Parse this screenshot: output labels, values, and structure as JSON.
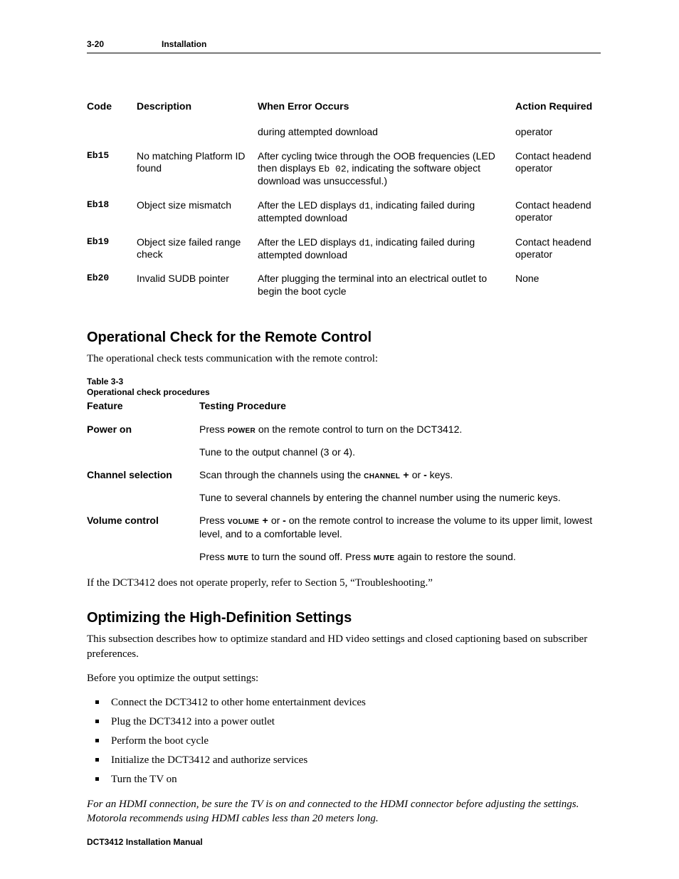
{
  "header": {
    "pagenum": "3-20",
    "section": "Installation"
  },
  "err_table": {
    "headers": {
      "code": "Code",
      "desc": "Description",
      "when": "When Error Occurs",
      "action": "Action Required"
    },
    "r0": {
      "when": "during attempted download",
      "action": "operator"
    },
    "r1": {
      "code": "Eb15",
      "desc": "No matching Platform ID found",
      "when_a": "After cycling twice through the OOB frequencies (LED then displays ",
      "when_code": "Eb 02",
      "when_b": ", indicating the software object download was unsuccessful.)",
      "action": "Contact headend operator"
    },
    "r2": {
      "code": "Eb18",
      "desc": "Object size mismatch",
      "when_a": "After the LED displays ",
      "when_code": "d1",
      "when_b": ", indicating failed during attempted download",
      "action": "Contact headend operator"
    },
    "r3": {
      "code": "Eb19",
      "desc": "Object size failed range check",
      "when_a": "After the LED displays ",
      "when_code": "d1",
      "when_b": ", indicating failed during attempted download",
      "action": "Contact headend operator"
    },
    "r4": {
      "code": "Eb20",
      "desc": "Invalid SUDB pointer",
      "when": "After plugging the terminal into an electrical outlet to begin the boot cycle",
      "action": "None"
    }
  },
  "sec1": {
    "title": "Operational Check for the Remote Control",
    "intro": "The operational check tests communication with the remote control:",
    "caption_a": "Table 3-3",
    "caption_b": "Operational check procedures",
    "headers": {
      "feat": "Feature",
      "proc": "Testing Procedure"
    },
    "rows": {
      "power": {
        "feat": "Power on",
        "l1a": "Press ",
        "l1b": "power",
        "l1c": " on the remote control to turn on the DCT3412.",
        "l2": "Tune to the output channel (3 or 4)."
      },
      "channel": {
        "feat": "Channel selection",
        "l1a": "Scan through the channels using the ",
        "l1b": "channel +",
        "l1c": " or ",
        "l1d": "-",
        "l1e": " keys.",
        "l2": "Tune to several channels by entering the channel number using the numeric keys."
      },
      "volume": {
        "feat": "Volume control",
        "l1a": "Press ",
        "l1b": "volume +",
        "l1c": " or ",
        "l1d": "-",
        "l1e": " on the remote control to increase the volume to its upper limit, lowest level, and to a comfortable level.",
        "l2a": "Press ",
        "l2b": "mute",
        "l2c": " to turn the sound off. Press ",
        "l2d": "mute",
        "l2e": " again to restore the sound."
      }
    },
    "closing": "If the DCT3412 does not operate properly, refer to Section 5, “Troubleshooting.”"
  },
  "sec2": {
    "title": "Optimizing the High-Definition Settings",
    "p1": "This subsection describes how to optimize standard and HD video settings and closed captioning based on subscriber preferences.",
    "p2": "Before you optimize the output settings:",
    "items": {
      "i1": "Connect the DCT3412 to other home entertainment devices",
      "i2": "Plug the DCT3412 into a power outlet",
      "i3": "Perform the boot cycle",
      "i4": "Initialize the DCT3412 and authorize services",
      "i5": "Turn the TV on"
    },
    "note": "For an HDMI connection, be sure the TV is on and connected to the HDMI connector before adjusting the settings. Motorola recommends using HDMI cables less than 20 meters long."
  },
  "footer": "DCT3412 Installation Manual"
}
